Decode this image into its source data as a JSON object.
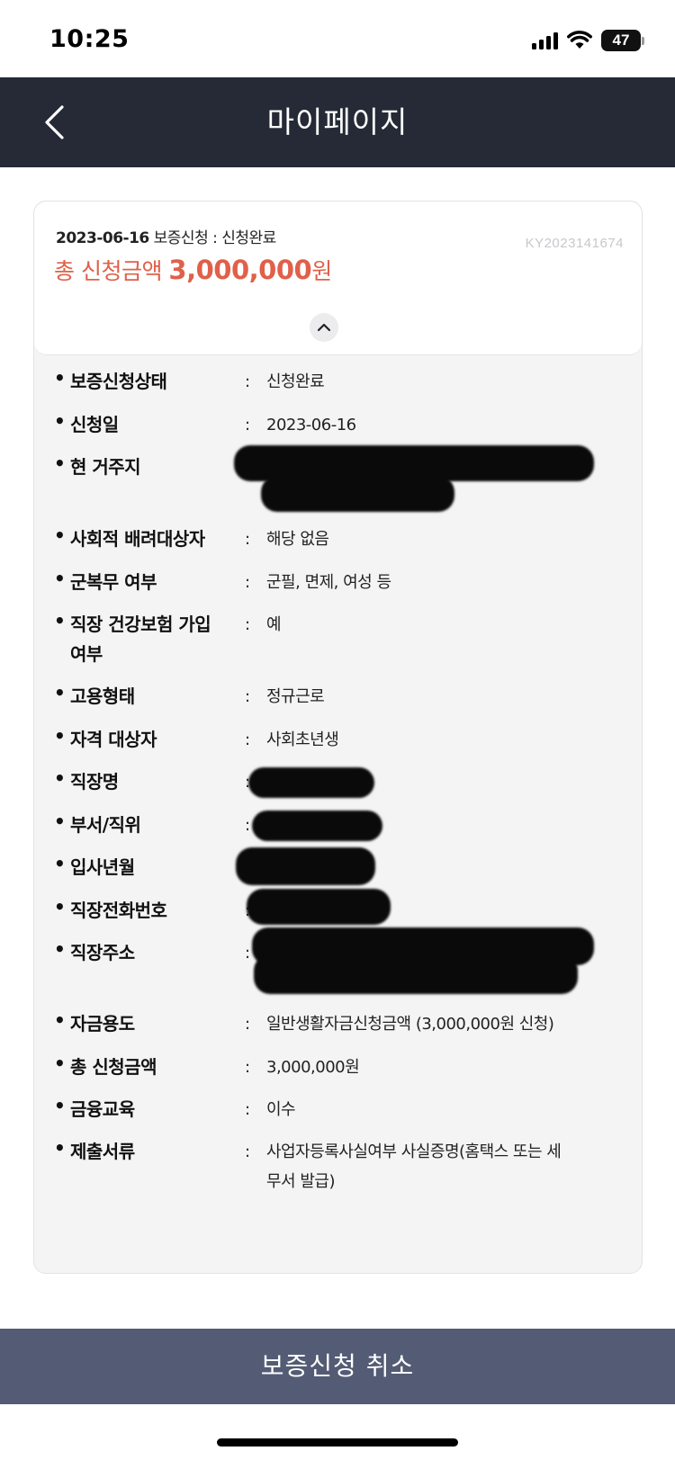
{
  "status_bar": {
    "time": "10:25",
    "battery": "47"
  },
  "header": {
    "title": "마이페이지",
    "back_icon": "chevron-left-icon"
  },
  "summary": {
    "date": "2023-06-16",
    "status_text": "보증신청 : 신청완료",
    "application_no": "KY2023141674",
    "total_label": "총 신청금액",
    "total_amount": "3,000,000",
    "total_unit": "원"
  },
  "details": [
    {
      "label": "보증신청상태",
      "value": "신청완료"
    },
    {
      "label": "신청일",
      "value": "2023-06-16"
    },
    {
      "label": "현 거주지",
      "value": ""
    },
    {
      "label": "사회적 배려대상자",
      "value": "해당 없음"
    },
    {
      "label": "군복무 여부",
      "value": "군필, 면제, 여성 등"
    },
    {
      "label": "직장 건강보험 가입 여부",
      "value": "예"
    },
    {
      "label": "고용형태",
      "value": "정규근로"
    },
    {
      "label": "자격 대상자",
      "value": "사회초년생"
    },
    {
      "label": "직장명",
      "value": ""
    },
    {
      "label": "부서/직위",
      "value": ""
    },
    {
      "label": "입사년월",
      "value": ""
    },
    {
      "label": "직장전화번호",
      "value": ""
    },
    {
      "label": "직장주소",
      "value": ""
    },
    {
      "label": "자금용도",
      "value": "일반생활자금신청금액 (3,000,000원 신청)"
    },
    {
      "label": "총 신청금액",
      "value": "3,000,000원"
    },
    {
      "label": "금융교육",
      "value": "이수"
    },
    {
      "label": "제출서류",
      "value": "사업자등록사실여부 사실증명(홈택스 또는 세무서 발급)"
    }
  ],
  "footer": {
    "cancel_label": "보증신청 취소"
  },
  "colors": {
    "header_bg": "#252a36",
    "accent": "#e0604a",
    "footer_bg": "#545b74"
  }
}
